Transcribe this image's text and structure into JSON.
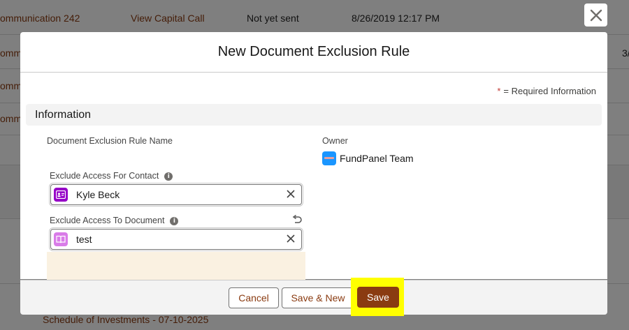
{
  "background": {
    "rows": [
      {
        "link": "ommunication 242",
        "action": "View Capital Call",
        "status": "Not yet sent",
        "date": "8/26/2019 12:17 PM"
      },
      {
        "link": "omm",
        "right_text": "3/"
      },
      {
        "link": "omm"
      },
      {
        "link": "omm"
      }
    ],
    "bottom_link": "Schedule of Investments - 07-10-2025"
  },
  "modal": {
    "title": "New Document Exclusion Rule",
    "required_star": "*",
    "required_text": "= Required Information",
    "section_title": "Information",
    "fields": {
      "rule_name_label": "Document Exclusion Rule Name",
      "owner_label": "Owner",
      "owner_value": "FundPanel Team",
      "contact_label": "Exclude Access For Contact",
      "contact_value": "Kyle Beck",
      "document_label": "Exclude Access To Document",
      "document_value": "test"
    },
    "buttons": {
      "cancel": "Cancel",
      "save_new": "Save & New",
      "save": "Save"
    }
  },
  "colors": {
    "brand": "#8a3b11",
    "highlight": "#ffff00",
    "contact_icon": "#9602c7",
    "document_icon": "#d97ce8",
    "owner_icon": "#1b96ff"
  },
  "icons": {
    "close": "close-icon",
    "info": "info-icon",
    "contact": "contact-icon",
    "document": "document-icon",
    "clear": "clear-icon",
    "undo": "undo-icon",
    "owner": "user-avatar-icon"
  }
}
